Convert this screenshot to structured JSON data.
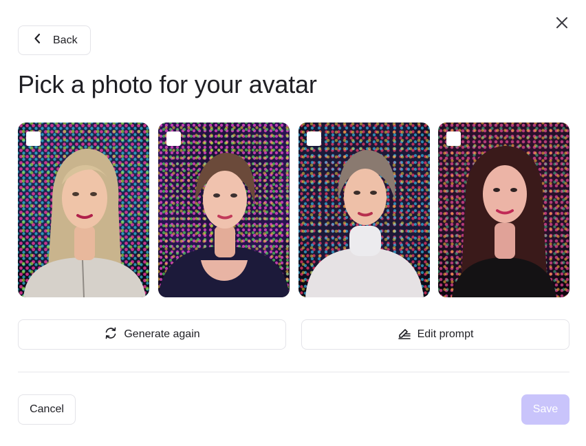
{
  "dialog": {
    "title": "Pick a photo for your avatar",
    "back_label": "Back",
    "close_icon": "close-icon"
  },
  "photos": [
    {
      "description": "Woman with blonde hair in light zip hoodie, colorful LED background",
      "selected": false
    },
    {
      "description": "Woman with brown hair in dark top, colorful LED tunnel background",
      "selected": false
    },
    {
      "description": "Woman with curly hair in white turtleneck, LED light background",
      "selected": false
    },
    {
      "description": "Woman with long dark hair in black top, LED light background",
      "selected": false
    }
  ],
  "actions": {
    "generate_again_label": "Generate again",
    "edit_prompt_label": "Edit prompt"
  },
  "footer": {
    "cancel_label": "Cancel",
    "save_label": "Save"
  },
  "colors": {
    "accent_disabled": "#c9c4fb",
    "text": "#1f1f24",
    "border": "#e3e3e8"
  }
}
